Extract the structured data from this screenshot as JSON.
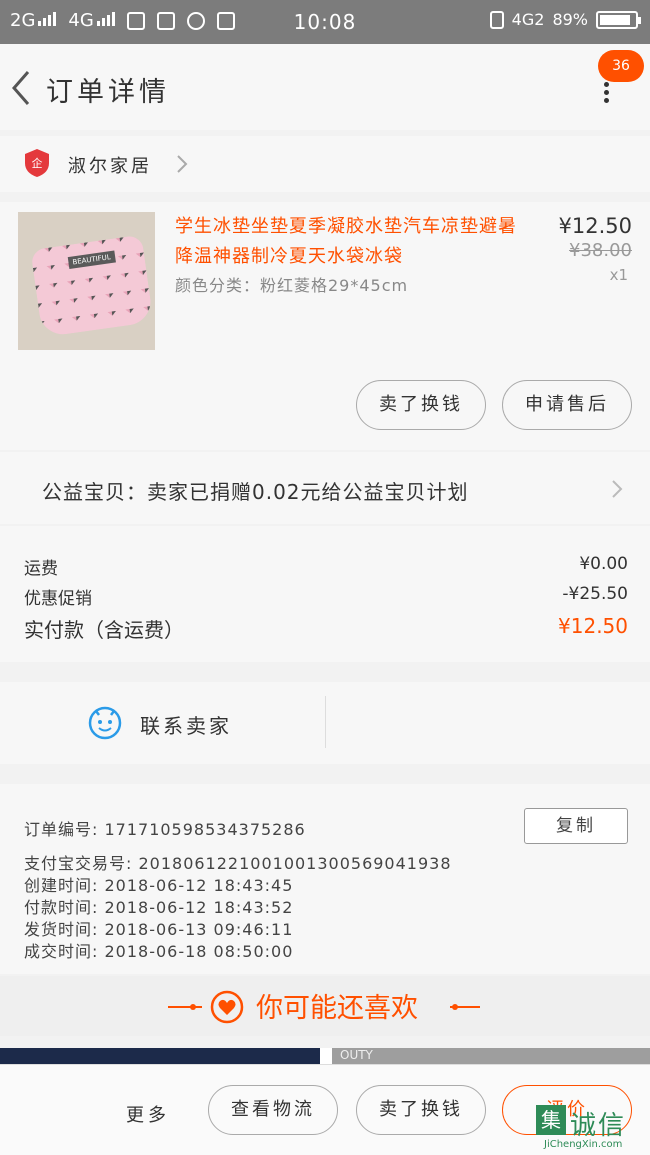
{
  "status_bar": {
    "network1": "2G",
    "network2": "4G",
    "time": "10:08",
    "network3": "4G2",
    "battery": "89%",
    "battery_level": 0.89
  },
  "header": {
    "title": "订单详情",
    "badge": "36"
  },
  "shop": {
    "name": "淑尔家居",
    "logo_text": "企"
  },
  "product": {
    "title": "学生冰垫坐垫夏季凝胶水垫汽车凉垫避暑降温神器制冷夏天水袋冰袋",
    "spec": "颜色分类：粉红菱格29*45cm",
    "price": "¥12.50",
    "original_price": "¥38.00",
    "quantity": "x1",
    "image_label": "BEAUTIFUL",
    "buttons": {
      "buy_again": "卖了换钱",
      "after_sale": "申请售后"
    }
  },
  "charity": {
    "text": "公益宝贝：卖家已捐赠0.02元给公益宝贝计划"
  },
  "fees": {
    "shipping_label": "运费",
    "shipping_value": "¥0.00",
    "discount_label": "优惠促销",
    "discount_value": "-¥25.50",
    "paid_label": "实付款（含运费）",
    "paid_value": "¥12.50"
  },
  "contact": {
    "label": "联系卖家"
  },
  "order_info": {
    "order_no": "订单编号:  171710598534375286",
    "alipay_no": "支付宝交易号:  2018061221001001300569041938",
    "created": "创建时间:  2018-06-12  18:43:45",
    "paid": "付款时间:  2018-06-12  18:43:52",
    "shipped": "发货时间:  2018-06-13  09:46:11",
    "completed": "成交时间:  2018-06-18  08:50:00",
    "copy_label": "复制"
  },
  "recommend": {
    "title": "你可能还喜欢"
  },
  "peek": {
    "text": "OUTY"
  },
  "bottom_bar": {
    "more": "更多",
    "logistics": "查看物流",
    "sell": "卖了换钱",
    "review": "评价"
  },
  "watermark": {
    "name": "诚信",
    "logo": "集",
    "url": "JiChengXin.com"
  },
  "colors": {
    "accent": "#ff5000",
    "status_bar": "#7c7c7c"
  }
}
